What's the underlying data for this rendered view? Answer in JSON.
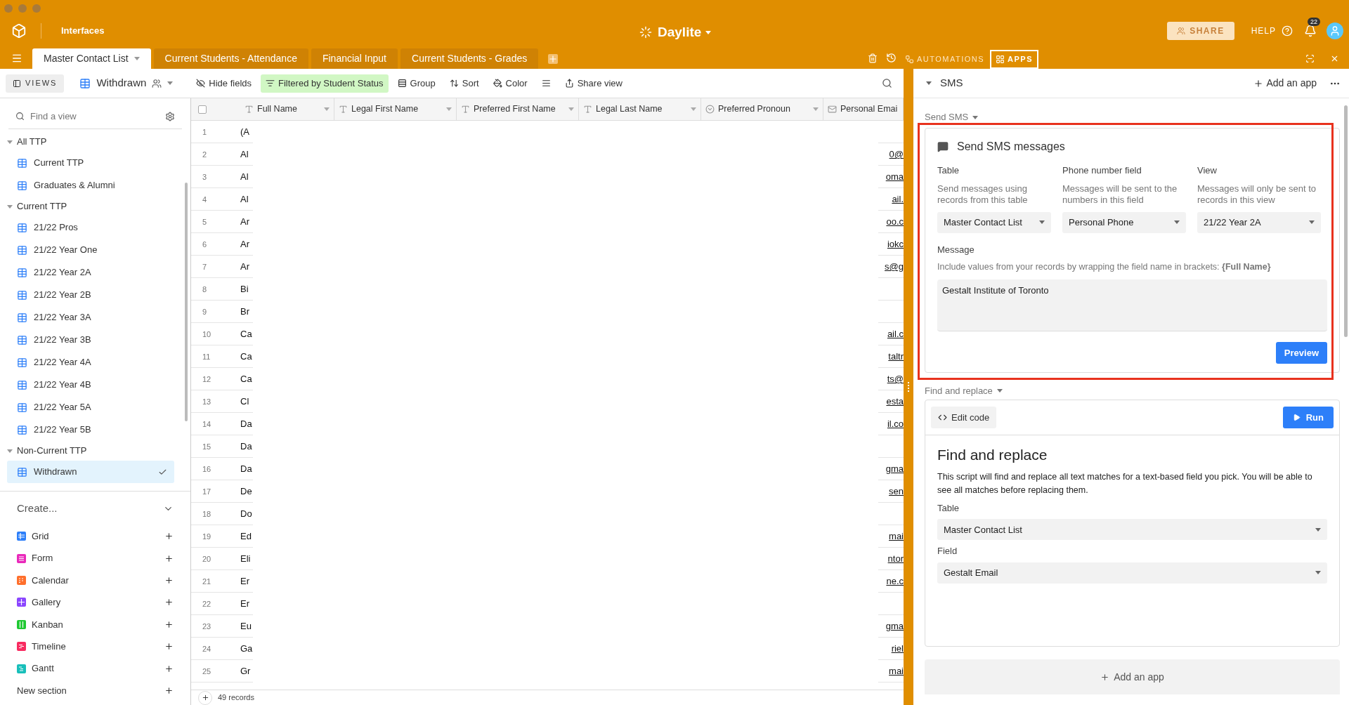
{
  "topbar": {
    "nav_label": "Interfaces",
    "base_name": "Daylite",
    "share": "SHARE",
    "help": "HELP",
    "notification_count": "22"
  },
  "tabs": [
    {
      "label": "Master Contact List",
      "selected": true
    },
    {
      "label": "Current Students - Attendance",
      "selected": false
    },
    {
      "label": "Financial Input",
      "selected": false
    },
    {
      "label": "Current Students - Grades",
      "selected": false
    }
  ],
  "panel_tabs": [
    {
      "label": "AUTOMATIONS",
      "selected": false
    },
    {
      "label": "APPS",
      "selected": true
    }
  ],
  "toolbar": {
    "views": "VIEWS",
    "view_name": "Withdrawn",
    "buttons": [
      {
        "kind": "hide",
        "label": "Hide fields",
        "active": false
      },
      {
        "kind": "filter",
        "label": "Filtered by Student Status",
        "active": true
      },
      {
        "kind": "group",
        "label": "Group",
        "active": false
      },
      {
        "kind": "sort",
        "label": "Sort",
        "active": false
      },
      {
        "kind": "color",
        "label": "Color",
        "active": false
      },
      {
        "kind": "height",
        "active": false
      },
      {
        "kind": "share",
        "label": "Share view",
        "active": false
      }
    ]
  },
  "sidebar": {
    "search_placeholder": "Find a view",
    "sections": [
      {
        "title": "All TTP",
        "expanded": true,
        "items": [
          {
            "label": "Current TTP",
            "selected": false
          },
          {
            "label": "Graduates & Alumni",
            "selected": false
          }
        ]
      },
      {
        "title": "Current TTP",
        "expanded": true,
        "items": [
          {
            "label": "21/22 Pros",
            "selected": false
          },
          {
            "label": "21/22 Year One",
            "selected": false
          },
          {
            "label": "21/22 Year 2A",
            "selected": false
          },
          {
            "label": "21/22 Year 2B",
            "selected": false
          },
          {
            "label": "21/22 Year 3A",
            "selected": false
          },
          {
            "label": "21/22 Year 3B",
            "selected": false
          },
          {
            "label": "21/22 Year 4A",
            "selected": false
          },
          {
            "label": "21/22 Year 4B",
            "selected": false
          },
          {
            "label": "21/22 Year 5A",
            "selected": false
          },
          {
            "label": "21/22 Year 5B",
            "selected": false
          }
        ]
      },
      {
        "title": "Non-Current TTP",
        "expanded": true,
        "items": [
          {
            "label": "Withdrawn",
            "selected": true
          }
        ]
      }
    ],
    "create": {
      "label": "Create...",
      "items": [
        {
          "kind": "grid",
          "label": "Grid",
          "color": "#2d7ff9"
        },
        {
          "kind": "form",
          "label": "Form",
          "color": "#e929ba"
        },
        {
          "kind": "calendar",
          "label": "Calendar",
          "color": "#ff6f2c"
        },
        {
          "kind": "gallery",
          "label": "Gallery",
          "color": "#8b46ff"
        },
        {
          "kind": "kanban",
          "label": "Kanban",
          "color": "#20c933"
        },
        {
          "kind": "timeline",
          "label": "Timeline",
          "color": "#f82b60"
        },
        {
          "kind": "gantt",
          "label": "Gantt",
          "color": "#18bfba"
        }
      ],
      "new_section": "New section"
    }
  },
  "grid": {
    "select_all_checked": false,
    "columns": [
      {
        "kind": "text",
        "label": "Full Name"
      },
      {
        "kind": "text",
        "label": "Legal First Name"
      },
      {
        "kind": "text",
        "label": "Preferred First Name"
      },
      {
        "kind": "text",
        "label": "Legal Last Name"
      },
      {
        "kind": "select",
        "label": "Preferred Pronoun"
      },
      {
        "kind": "email",
        "label": "Personal Emai"
      }
    ],
    "rows": [
      {
        "number": "1",
        "full_name": "(A",
        "email": ""
      },
      {
        "number": "2",
        "full_name": "Al",
        "email": "0@"
      },
      {
        "number": "3",
        "full_name": "Al",
        "email": "oma"
      },
      {
        "number": "4",
        "full_name": "Al",
        "email": "ail."
      },
      {
        "number": "5",
        "full_name": "Ar",
        "email": "oo.c"
      },
      {
        "number": "6",
        "full_name": "Ar",
        "email": "iokc"
      },
      {
        "number": "7",
        "full_name": "Ar",
        "email": "s@g"
      },
      {
        "number": "8",
        "full_name": "Bi",
        "email": ""
      },
      {
        "number": "9",
        "full_name": "Br",
        "email": ""
      },
      {
        "number": "10",
        "full_name": "Ca",
        "email": "ail.c"
      },
      {
        "number": "11",
        "full_name": "Ca",
        "email": "taltr"
      },
      {
        "number": "12",
        "full_name": "Ca",
        "email": "ts@"
      },
      {
        "number": "13",
        "full_name": "Cl",
        "email": "esta"
      },
      {
        "number": "14",
        "full_name": "Da",
        "email": "il.co"
      },
      {
        "number": "15",
        "full_name": "Da",
        "email": ""
      },
      {
        "number": "16",
        "full_name": "Da",
        "email": "gma"
      },
      {
        "number": "17",
        "full_name": "De",
        "email": "sen"
      },
      {
        "number": "18",
        "full_name": "Do",
        "email": ""
      },
      {
        "number": "19",
        "full_name": "Ed",
        "email": "mai"
      },
      {
        "number": "20",
        "full_name": "Eli",
        "email": "ntor"
      },
      {
        "number": "21",
        "full_name": "Er",
        "email": "ne.c"
      },
      {
        "number": "22",
        "full_name": "Er",
        "email": ""
      },
      {
        "number": "23",
        "full_name": "Eu",
        "email": "gma"
      },
      {
        "number": "24",
        "full_name": "Ga",
        "email": "riel"
      },
      {
        "number": "25",
        "full_name": "Gr",
        "email": "mai"
      }
    ],
    "record_count": "49 records"
  },
  "apps_panel": {
    "title": "SMS",
    "add_app": "Add an app",
    "sms_app": {
      "label": "Send SMS",
      "title": "Send SMS messages",
      "fields": [
        {
          "label": "Table",
          "description": "Send messages using records from this table",
          "value": "Master Contact List"
        },
        {
          "label": "Phone number field",
          "description": "Messages will be sent to the numbers in this field",
          "value": "Personal Phone"
        },
        {
          "label": "View",
          "description": "Messages will only be sent to records in this view",
          "value": "21/22 Year 2A"
        }
      ],
      "message_label": "Message",
      "message_hint": "Include values from your records by wrapping the field name in brackets: **{Full Name}**",
      "message": "Gestalt Institute of Toronto",
      "button": "Preview"
    },
    "script_app": {
      "label": "Find and replace",
      "edit_code": "Edit code",
      "run": "Run",
      "title": "Find and replace",
      "description": "This script will find and replace all text matches for a text-based field you pick. You will be able to see all matches before replacing them.",
      "fields": [
        {
          "label": "Table",
          "value": "Master Contact List"
        },
        {
          "label": "Field",
          "value": "Gestalt Email"
        }
      ]
    },
    "add_app_bottom": "Add an app"
  }
}
